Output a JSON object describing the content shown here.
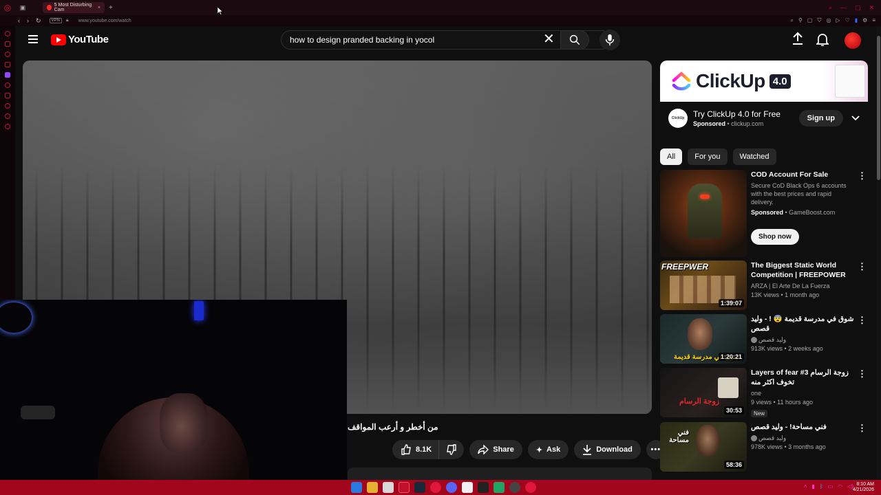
{
  "browser": {
    "tab_title": "5 Most Disturbing Cam",
    "url": "www.youtube.com/watch",
    "vpn_label": "VPN"
  },
  "masthead": {
    "logo_text": "YouTube",
    "search_value": "how to design pranded backing in yocol"
  },
  "video": {
    "title": "من أخطر و أرعب المواقف",
    "like_count": "8.1K",
    "share_label": "Share",
    "ask_label": "Ask",
    "download_label": "Download"
  },
  "ad": {
    "banner_brand": "ClickUp",
    "banner_version": "4.0",
    "brand_icon_text": "ClickUp",
    "headline": "Try ClickUp 4.0 for Free",
    "sponsored": "Sponsored",
    "domain": "clickup.com",
    "cta": "Sign up"
  },
  "chips": [
    "All",
    "For you",
    "Watched"
  ],
  "recommendations": [
    {
      "title": "COD Account For Sale",
      "desc": "Secure CoD Black Ops 6 accounts with the best prices and rapid delivery.",
      "sponsored": "Sponsored",
      "advertiser": "GameBoost.com",
      "cta": "Shop now"
    },
    {
      "title": "The Biggest Static World Competition | FREEPOWER",
      "channel": "ARZA | El Arte De La Fuerza",
      "stats": "13K views • 1 month ago",
      "duration": "1:39:07",
      "thumb_text": "FREEPWER"
    },
    {
      "title": "شوق في مدرسة قديمة 😨 ! - وليد قصص",
      "channel": "وليد قصص",
      "stats": "913K views • 2 weeks ago",
      "duration": "1:20:21",
      "thumb_text": "شوق في مدرسة قديمة"
    },
    {
      "title": "Layers of fear #3 زوجة الرسام تخوف اكثر منه",
      "channel": "one",
      "stats": "9 views • 11 hours ago",
      "badge": "New",
      "duration": "30:53",
      "thumb_text": "زوجة الرسام"
    },
    {
      "title": "فني مساحة! - وليد قصص",
      "channel": "وليد قصص",
      "stats": "978K views • 3 months ago",
      "duration": "58:36",
      "thumb_text": "فني مساحة"
    }
  ],
  "taskbar": {
    "time": "8:10 AM",
    "date": "4/21/2026"
  },
  "colors": {
    "accent": "#ff0000",
    "taskbar": "#a1061c",
    "browser_frame": "#1b0a10"
  }
}
